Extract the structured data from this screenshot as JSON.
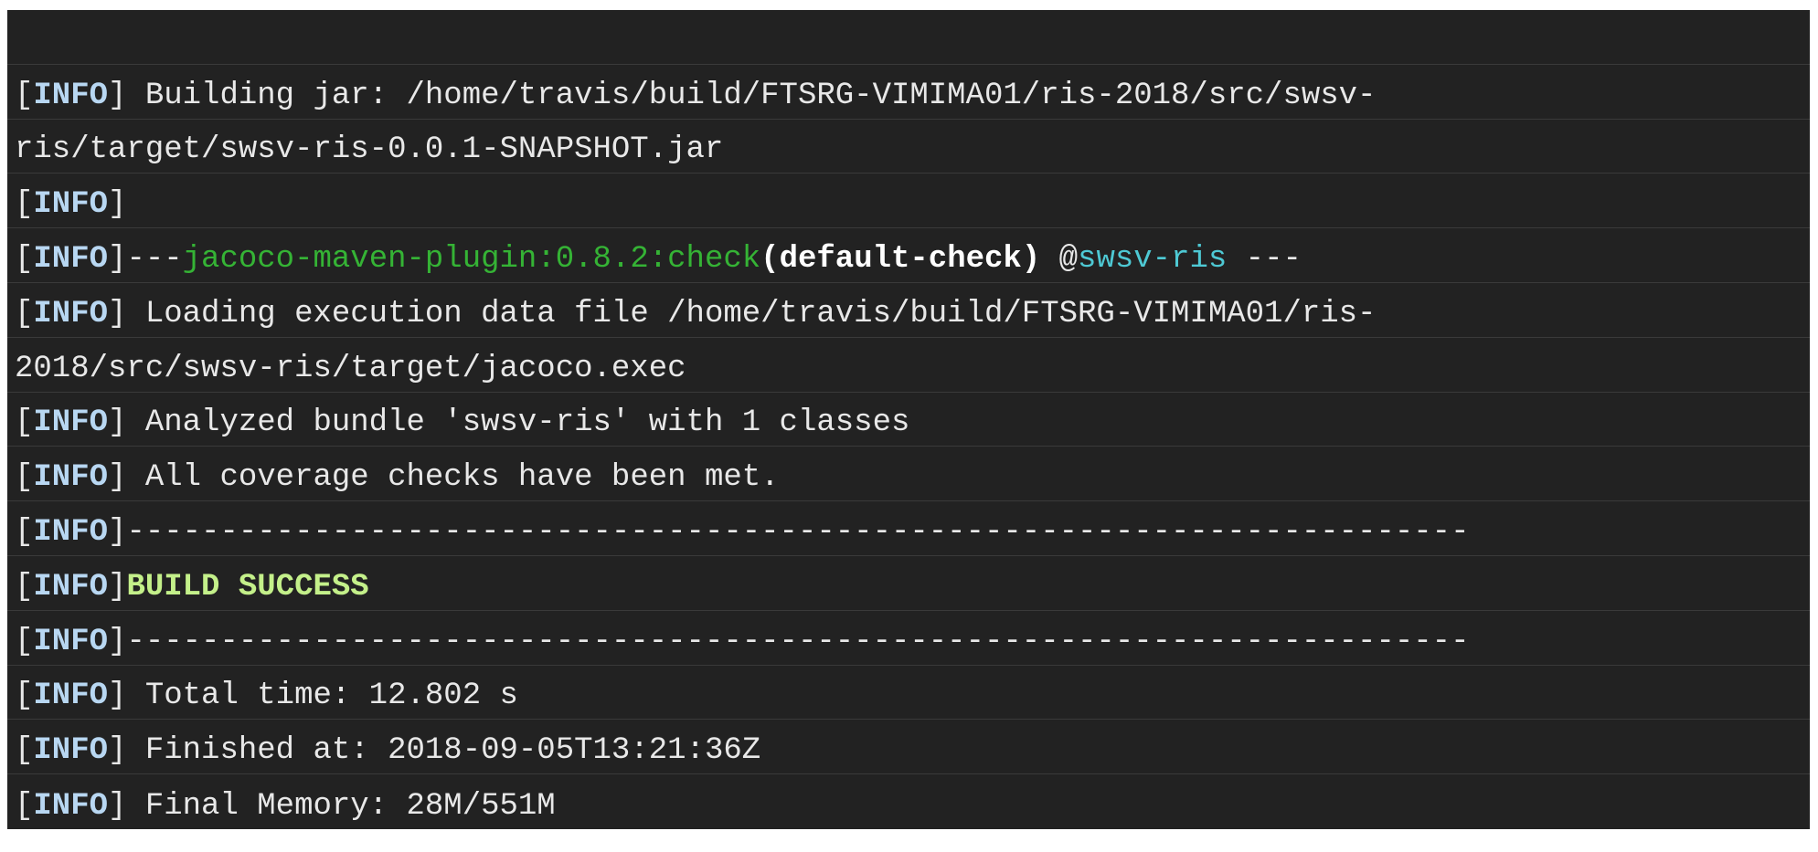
{
  "terminal": {
    "tag": "INFO",
    "lines": {
      "l1": " Building jar: /home/travis/build/FTSRG-VIMIMA01/ris-2018/src/swsv-",
      "l2": "ris/target/swsv-ris-0.0.1-SNAPSHOT.jar",
      "l4_prefix": "---",
      "l4_plugin": "jacoco-maven-plugin:0.8.2:check",
      "l4_goal": "(default-check)",
      "l4_at": " @",
      "l4_module": "swsv-ris",
      "l4_suffix": " ---",
      "l5": " Loading execution data file /home/travis/build/FTSRG-VIMIMA01/ris-",
      "l6": "2018/src/swsv-ris/target/jacoco.exec",
      "l7": " Analyzed bundle 'swsv-ris' with 1 classes",
      "l8": " All coverage checks have been met.",
      "separator": "------------------------------------------------------------------------",
      "success": "BUILD SUCCESS",
      "l12": " Total time: 12.802 s",
      "l13": " Finished at: 2018-09-05T13:21:36Z",
      "l14": " Final Memory: 28M/551M"
    }
  },
  "colors": {
    "background": "#222222",
    "tag": "#b8d7f2",
    "plugin": "#35b335",
    "module": "#4ec9d4",
    "success": "#c4f08a"
  }
}
